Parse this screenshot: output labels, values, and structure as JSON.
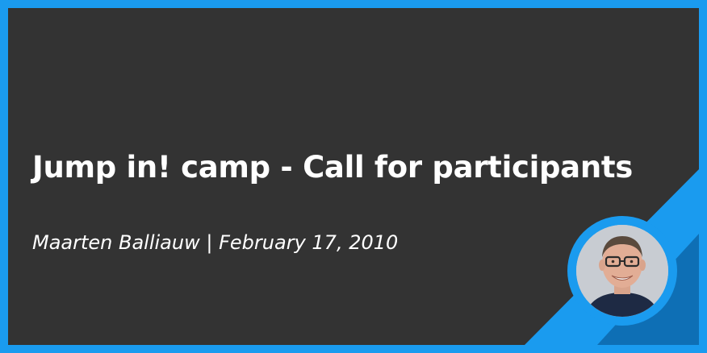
{
  "post": {
    "title": "Jump in! camp - Call for participants",
    "author": "Maarten Balliauw",
    "separator": "|",
    "date": "February 17, 2010"
  },
  "colors": {
    "frame": "#1a9bef",
    "panel": "#333333",
    "stripe_dark": "#0e6fb5",
    "text": "#ffffff"
  },
  "avatar": {
    "icon": "author-photo"
  }
}
